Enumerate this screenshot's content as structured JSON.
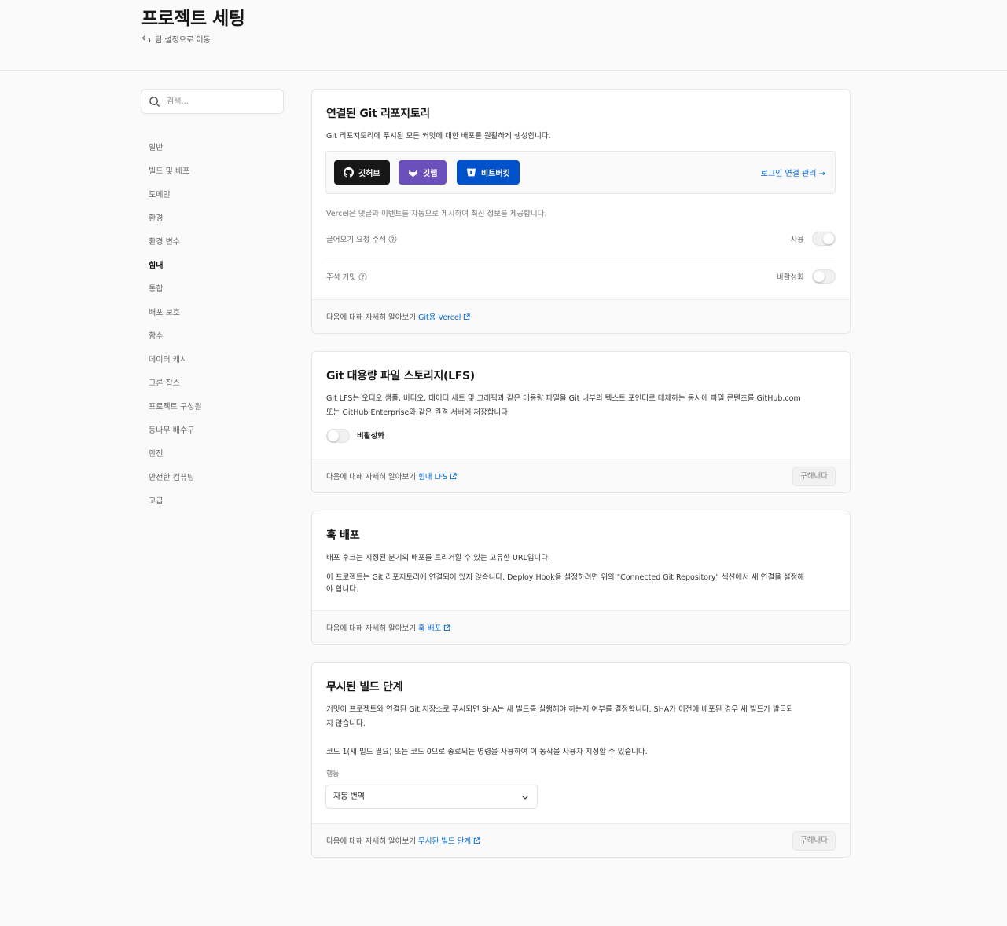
{
  "header": {
    "title": "프로젝트 세팅",
    "back_label": "팀 설정으로 이동"
  },
  "search": {
    "placeholder": "검색..."
  },
  "sidebar": {
    "items": [
      {
        "label": "일반",
        "active": false
      },
      {
        "label": "빌드 및 배포",
        "active": false
      },
      {
        "label": "도메인",
        "active": false
      },
      {
        "label": "환경",
        "active": false
      },
      {
        "label": "환경 변수",
        "active": false
      },
      {
        "label": "힘내",
        "active": true
      },
      {
        "label": "통합",
        "active": false
      },
      {
        "label": "배포 보호",
        "active": false
      },
      {
        "label": "함수",
        "active": false
      },
      {
        "label": "데이터 캐시",
        "active": false
      },
      {
        "label": "크론 잡스",
        "active": false
      },
      {
        "label": "프로젝트 구성원",
        "active": false
      },
      {
        "label": "등나무 배수구",
        "active": false
      },
      {
        "label": "안전",
        "active": false
      },
      {
        "label": "안전한 컴퓨팅",
        "active": false
      },
      {
        "label": "고급",
        "active": false
      }
    ]
  },
  "git_card": {
    "title": "연결된 Git 리포지토리",
    "description": "Git 리포지토리에 푸시된 모든 커밋에 대한 배포를 원활하게 생성합니다.",
    "providers": [
      {
        "label": "깃허브",
        "icon": "github-icon",
        "color": "#171717"
      },
      {
        "label": "깃랩",
        "icon": "gitlab-icon",
        "color": "#6b4fbb"
      },
      {
        "label": "비트버킷",
        "icon": "bitbucket-icon",
        "color": "#0052cc"
      }
    ],
    "manage_link": "로그인 연결 관리 →",
    "vercel_note": "Vercel은 댓글과 이벤트를 자동으로 게시하여 최신 정보를 제공합니다.",
    "pr_comments_label": "끌어오기 요청 주석",
    "pr_comments_status": "사용",
    "pr_comments_enabled": true,
    "commit_comments_label": "주석 커밋",
    "commit_comments_status": "비활성화",
    "commit_comments_enabled": false,
    "footer_text": "다음에 대해 자세히 알아보기",
    "footer_link": "Git용 Vercel"
  },
  "lfs_card": {
    "title": "Git 대용량 파일 스토리지(LFS)",
    "description_1": "Git LFS는 오디오 샘플, 비디오, 데이터 세트 및 그래픽과 같은 대용량 파일을 Git 내부의 텍스트 포인터로 대체하는 동시에 파일 콘텐츠를 GitHub.com",
    "description_2": "또는 GitHub Enterprise와 같은 원격 서버에 저장합니다.",
    "toggle_label": "비활성화",
    "enabled": false,
    "footer_text": "다음에 대해 자세히 알아보기",
    "footer_link": "힘내 LFS",
    "save_label": "구해내다"
  },
  "hook_card": {
    "title": "훅 배포",
    "description": "배포 후크는 지정된 분기의 배포를 트리거할 수 있는 고유한 URL입니다.",
    "notice_1": "이 프로젝트는 Git 리포지토리에 연결되어 있지 않습니다. Deploy Hook을 설정하려면 위의 \"Connected Git Repository\" 섹션에서 새 연결을 설정해",
    "notice_2": "야 합니다.",
    "footer_text": "다음에 대해 자세히 알아보기",
    "footer_link": "훅 배포"
  },
  "ignored_card": {
    "title": "무시된 빌드 단계",
    "description_1": "커밋이 프로젝트와 연결된 Git 저장소로 푸시되면 SHA는 새 빌드를 실행해야 하는지 여부를 결정합니다. SHA가 이전에 배포된 경우 새 빌드가 발급되",
    "description_2": "지 않습니다.",
    "description_3": "코드 1(새 빌드 필요) 또는 코드 0으로 종료되는 명령을 사용하여 이 동작을 사용자 지정할 수 있습니다.",
    "behavior_label": "행동",
    "behavior_value": "자동 번역",
    "footer_text": "다음에 대해 자세히 알아보기",
    "footer_link": "무시된 빌드 단계",
    "save_label": "구해내다"
  },
  "colors": {
    "link": "#0068d6",
    "background": "#fafafa"
  }
}
